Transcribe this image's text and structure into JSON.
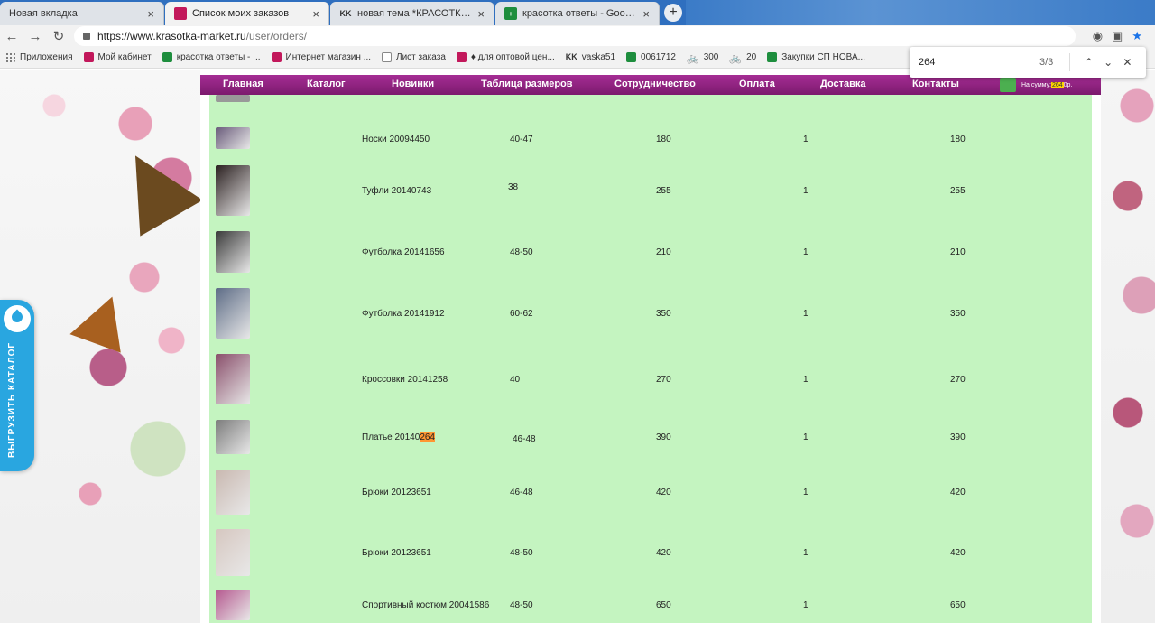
{
  "browser": {
    "tabs": [
      {
        "title": "Новая вкладка",
        "icon": "none",
        "active": false
      },
      {
        "title": "Список моих заказов",
        "icon": "bag",
        "active": true
      },
      {
        "title": "новая тема *КРАСОТКА МАРКЕТ",
        "icon": "kk",
        "active": false
      },
      {
        "title": "красотка ответы - Google Табл",
        "icon": "sheet",
        "active": false
      }
    ],
    "newtab_label": "+",
    "url_host": "https://www.krasotka-market.ru",
    "url_path": "/user/orders/",
    "bookmarks": [
      {
        "label": "Приложения",
        "icon": "apps"
      },
      {
        "label": "Мой кабинет",
        "icon": "bag"
      },
      {
        "label": "красотка ответы - ...",
        "icon": "sheet"
      },
      {
        "label": "Интернет магазин ...",
        "icon": "bag"
      },
      {
        "label": "Лист заказа",
        "icon": "doc"
      },
      {
        "label": "♦ для оптовой цен...",
        "icon": "bag"
      },
      {
        "label": "vaska51",
        "icon": "kk"
      },
      {
        "label": "0061712",
        "icon": "sheet"
      },
      {
        "label": "300",
        "icon": "bike"
      },
      {
        "label": "20",
        "icon": "bike"
      },
      {
        "label": "Закупки СП НОВА...",
        "icon": "sheet"
      }
    ],
    "find": {
      "query": "264",
      "count": "3/3"
    }
  },
  "site": {
    "nav": [
      "Главная",
      "Каталог",
      "Новинки",
      "Таблица размеров",
      "Сотрудничество",
      "Оплата",
      "Доставка",
      "Контакты"
    ],
    "cart_label": "На сумму:",
    "cart_sum": "264",
    "cart_currency": "0р.",
    "side_catalog_label": "ВЫГРУЗИТЬ КАТАЛОГ"
  },
  "orders": [
    {
      "name": "Носки 20094450",
      "size": "40-47",
      "price": "180",
      "qty": "1",
      "total": "180",
      "thumb_color": "#6a5b7b"
    },
    {
      "name": "Туфли 20140743",
      "size": "38",
      "price": "255",
      "qty": "1",
      "total": "255",
      "thumb_color": "#2b2020"
    },
    {
      "name": "Футболка 20141656",
      "size": "48-50",
      "price": "210",
      "qty": "1",
      "total": "210",
      "thumb_color": "#3a3a3a"
    },
    {
      "name": "Футболка 20141912",
      "size": "60-62",
      "price": "350",
      "qty": "1",
      "total": "350",
      "thumb_color": "#5d6c86"
    },
    {
      "name": "Кроссовки 20141258",
      "size": "40",
      "price": "270",
      "qty": "1",
      "total": "270",
      "thumb_color": "#8a4f6b"
    },
    {
      "name_prefix": "Платье 20140",
      "name_highlight": "264",
      "size": "46-48",
      "price": "390",
      "qty": "1",
      "total": "390",
      "thumb_color": "#7c7c7c"
    },
    {
      "name": "Брюки 20123651",
      "size": "46-48",
      "price": "420",
      "qty": "1",
      "total": "420",
      "thumb_color": "#c9b8b0"
    },
    {
      "name": "Брюки 20123651",
      "size": "48-50",
      "price": "420",
      "qty": "1",
      "total": "420",
      "thumb_color": "#d6c7c0"
    },
    {
      "name": "Спортивный костюм 20041586",
      "size": "48-50",
      "price": "650",
      "qty": "1",
      "total": "650",
      "thumb_color": "#b5588f"
    }
  ]
}
